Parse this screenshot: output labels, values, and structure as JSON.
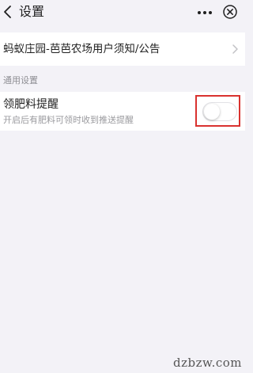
{
  "header": {
    "title": "设置",
    "icons": [
      "back-icon",
      "more-icon",
      "close-icon"
    ]
  },
  "notice": {
    "label": "蚂蚁庄园-芭芭农场用户须知/公告"
  },
  "general": {
    "section_label": "通用设置",
    "fertilizer_reminder": {
      "title": "领肥料提醒",
      "description": "开启后有肥料可领时收到推送提醒",
      "enabled": false
    }
  },
  "watermark": "dzbzw.com",
  "colors": {
    "background": "#f3f2f7",
    "highlight": "#d9322f"
  }
}
